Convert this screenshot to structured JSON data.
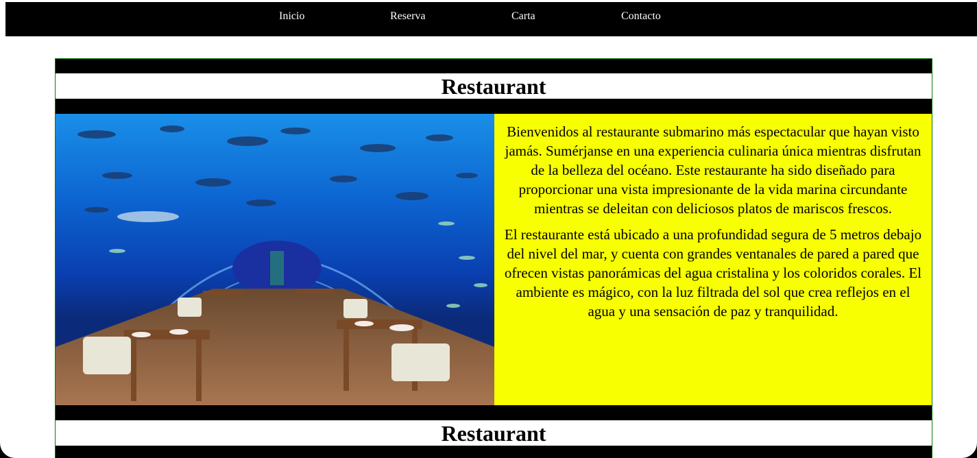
{
  "nav": {
    "items": [
      "Inicio",
      "Reserva",
      "Carta",
      "Contacto"
    ]
  },
  "section": {
    "title": "Restaurant",
    "paragraphs": [
      "Bienvenidos al restaurante submarino más espectacular que hayan visto jamás. Sumérjanse en una experiencia culinaria única mientras disfrutan de la belleza del océano. Este restaurante ha sido diseñado para proporcionar una vista impresionante de la vida marina circundante mientras se deleitan con deliciosos platos de mariscos frescos.",
      "El restaurante está ubicado a una profundidad segura de 5 metros debajo del nivel del mar, y cuenta con grandes ventanales de pared a pared que ofrecen vistas panorámicas del agua cristalina y los coloridos corales. El ambiente es mágico, con la luz filtrada del sol que crea reflejos en el agua y una sensación de paz y tranquilidad."
    ]
  },
  "section2": {
    "title": "Restaurant"
  },
  "colors": {
    "nav_bg": "#000000",
    "text_panel_bg": "#f7ff00",
    "card_border": "#0a7a0a"
  },
  "hero_image": {
    "icon": "underwater-restaurant-photo"
  }
}
